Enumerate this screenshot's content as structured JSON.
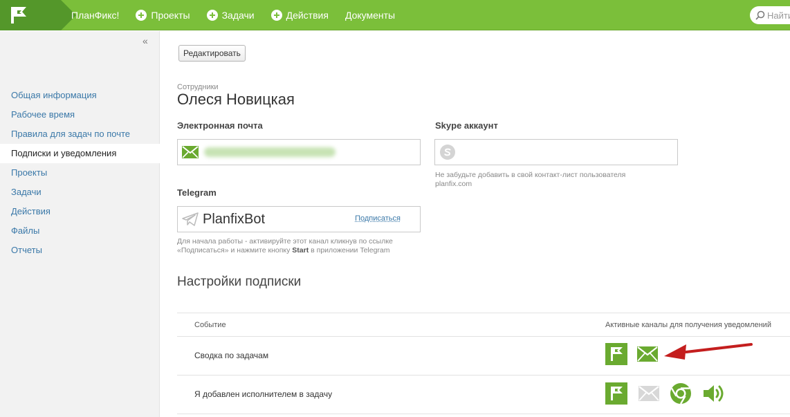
{
  "header": {
    "brand": "ПланФикс!",
    "nav": [
      {
        "label": "Проекты"
      },
      {
        "label": "Задачи"
      },
      {
        "label": "Действия"
      },
      {
        "label": "Документы"
      }
    ],
    "search_placeholder": "Найти"
  },
  "sidebar": {
    "collapse_glyph": "«",
    "items": [
      {
        "label": "Общая информация"
      },
      {
        "label": "Рабочее время"
      },
      {
        "label": "Правила для задач по почте"
      },
      {
        "label": "Подписки и уведомления",
        "active": true
      },
      {
        "label": "Проекты"
      },
      {
        "label": "Задачи"
      },
      {
        "label": "Действия"
      },
      {
        "label": "Файлы"
      },
      {
        "label": "Отчеты"
      }
    ]
  },
  "main": {
    "edit_button": "Редактировать",
    "breadcrumb": "Сотрудники",
    "person_name": "Олеся Новицкая",
    "email": {
      "label": "Электронная почта"
    },
    "skype": {
      "label": "Skype аккаунт",
      "hint": "Не забудьте добавить в свой контакт-лист пользователя planfix.com"
    },
    "telegram": {
      "label": "Telegram",
      "bot_name": "PlanfixBot",
      "subscribe": "Подписаться",
      "hint_part1": "Для начала работы - активируйте этот канал кликнув по ссылке «Подписаться» и нажмите кнопку",
      "hint_bold": "Start",
      "hint_part2": "в приложении Telegram"
    },
    "subscriptions": {
      "title": "Настройки подписки",
      "col_event": "Событие",
      "col_channels": "Активные каналы для получения уведомлений",
      "rows": [
        {
          "event": "Сводка по задачам",
          "channels": [
            "planfix-active",
            "email-active"
          ]
        },
        {
          "event": "Я добавлен исполнителем в задачу",
          "channels": [
            "planfix-active",
            "email-inactive",
            "chrome-active",
            "sound-active"
          ]
        }
      ]
    }
  },
  "colors": {
    "topbar": "#7bbf3a",
    "logo_block": "#54972a",
    "channel_active": "#6aaa30",
    "channel_inactive": "#d8d8d8",
    "arrow": "#c41e1e",
    "link": "#3a78a8"
  }
}
